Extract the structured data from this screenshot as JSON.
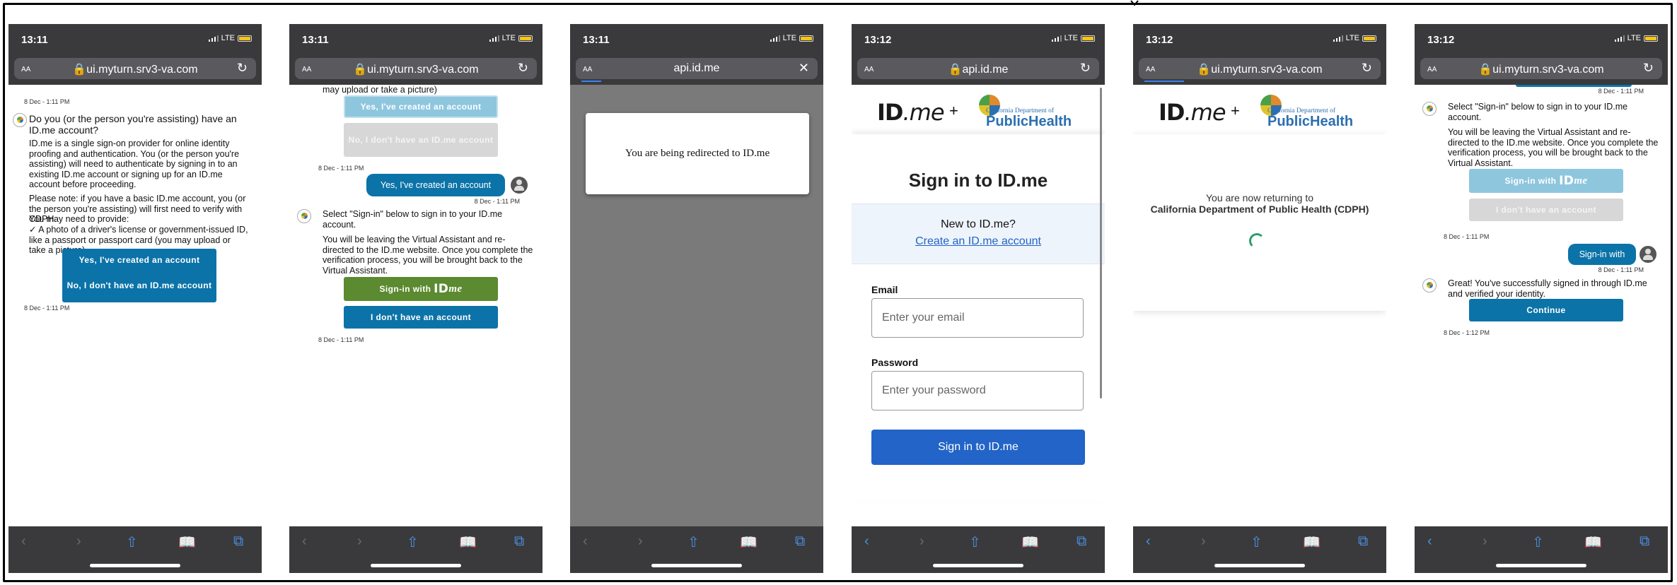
{
  "screens": [
    {
      "time": "13:11",
      "network": "LTE",
      "aa": "AA",
      "url": "ui.myturn.srv3-va.com",
      "url_action_icon": "reload-icon",
      "ts_top": "8 Dec - 1:11 PM",
      "question": "Do you (or the person you're assisting) have an ID.me account?",
      "para1": "ID.me is a single sign-on provider for online identity proofing and authentication. You (or the person you're assisting) will need to authenticate by signing in to an existing ID.me account or signing up for an ID.me account before proceeding.",
      "para2": "Please note: if you have a basic ID.me account, you (or the person you're assisting) will first need to verify with CDPH.",
      "para3": "You may need to provide:",
      "para4": "✓ A photo of a driver's license or government-issued ID, like a passport or passport card (you may upload or take a picture)",
      "btn_yes": "Yes, I've created an account",
      "btn_no": "No, I don't have an ID.me account",
      "ts_bottom": "8 Dec - 1:11 PM"
    },
    {
      "time": "13:11",
      "network": "LTE",
      "aa": "AA",
      "url": "ui.myturn.srv3-va.com",
      "url_action_icon": "reload-icon",
      "top_text": "may upload or take a picture)",
      "btn_yes": "Yes, I've created an account",
      "btn_no": "No, I don't have an ID.me account",
      "ts1": "8 Dec - 1:11 PM",
      "user_msg": "Yes, I've created an account",
      "ts2": "8 Dec - 1:11 PM",
      "select_msg": "Select \"Sign-in\" below to sign in to your ID.me account.",
      "leave_msg": "You will be leaving the Virtual Assistant and re-directed to the ID.me website. Once you complete the verification process, you will be brought back to the Virtual Assistant.",
      "btn_signin_prefix": "Sign-in with",
      "btn_signin_brand_a": "ID",
      "btn_signin_brand_b": "me",
      "btn_no_account": "I don't have an account",
      "ts3": "8 Dec - 1:11 PM"
    },
    {
      "time": "13:11",
      "network": "LTE",
      "aa": "AA",
      "url": "api.id.me",
      "url_action_icon": "close-icon",
      "redirect_msg": "You are being redirected to ID.me"
    },
    {
      "time": "13:12",
      "network": "LTE",
      "aa": "AA",
      "url": "api.id.me",
      "url_action_icon": "reload-icon",
      "logo_a": "ID",
      "logo_b": "me",
      "plus": "+",
      "cdph_small": "California Department of",
      "cdph_big": "PublicHealth",
      "heading": "Sign in to ID.me",
      "new_q": "New to ID.me?",
      "create_link": "Create an ID.me account",
      "email_label": "Email",
      "email_placeholder": "Enter your email",
      "password_label": "Password",
      "password_placeholder": "Enter your password",
      "signin_btn": "Sign in to ID.me"
    },
    {
      "time": "13:12",
      "network": "LTE",
      "aa": "AA",
      "url": "ui.myturn.srv3-va.com",
      "url_action_icon": "reload-icon",
      "logo_a": "ID",
      "logo_b": "me",
      "plus": "+",
      "cdph_small": "California Department of",
      "cdph_big": "PublicHealth",
      "returning": "You are now returning to",
      "returning_org": "California Department of Public Health (CDPH)"
    },
    {
      "time": "13:12",
      "network": "LTE",
      "aa": "AA",
      "url": "ui.myturn.srv3-va.com",
      "url_action_icon": "reload-icon",
      "ts0": "8 Dec - 1:11 PM",
      "select_msg": "Select \"Sign-in\" below to sign in to your ID.me account.",
      "leave_msg": "You will be leaving the Virtual Assistant and re-directed to the ID.me website. Once you complete the verification process, you will be brought back to the Virtual Assistant.",
      "btn_signin_prefix": "Sign-in with",
      "btn_signin_brand_a": "ID",
      "btn_signin_brand_b": "me",
      "btn_no_account": "I don't have an account",
      "ts1": "8 Dec - 1:11 PM",
      "user_msg": "Sign-in with",
      "ts2": "8 Dec - 1:11 PM",
      "success_msg": "Great! You've successfully signed in through ID.me and verified your identity.",
      "btn_continue": "Continue",
      "ts3": "8 Dec - 1:12 PM"
    }
  ],
  "toolbar_icons": [
    "back-icon",
    "forward-icon",
    "share-icon",
    "bookmarks-icon",
    "tabs-icon"
  ],
  "colors": {
    "chrome": "#3a3a3c",
    "bot_button": "#0b73a8",
    "idme_button": "#2264c7",
    "accent_green": "#5b8a30"
  }
}
